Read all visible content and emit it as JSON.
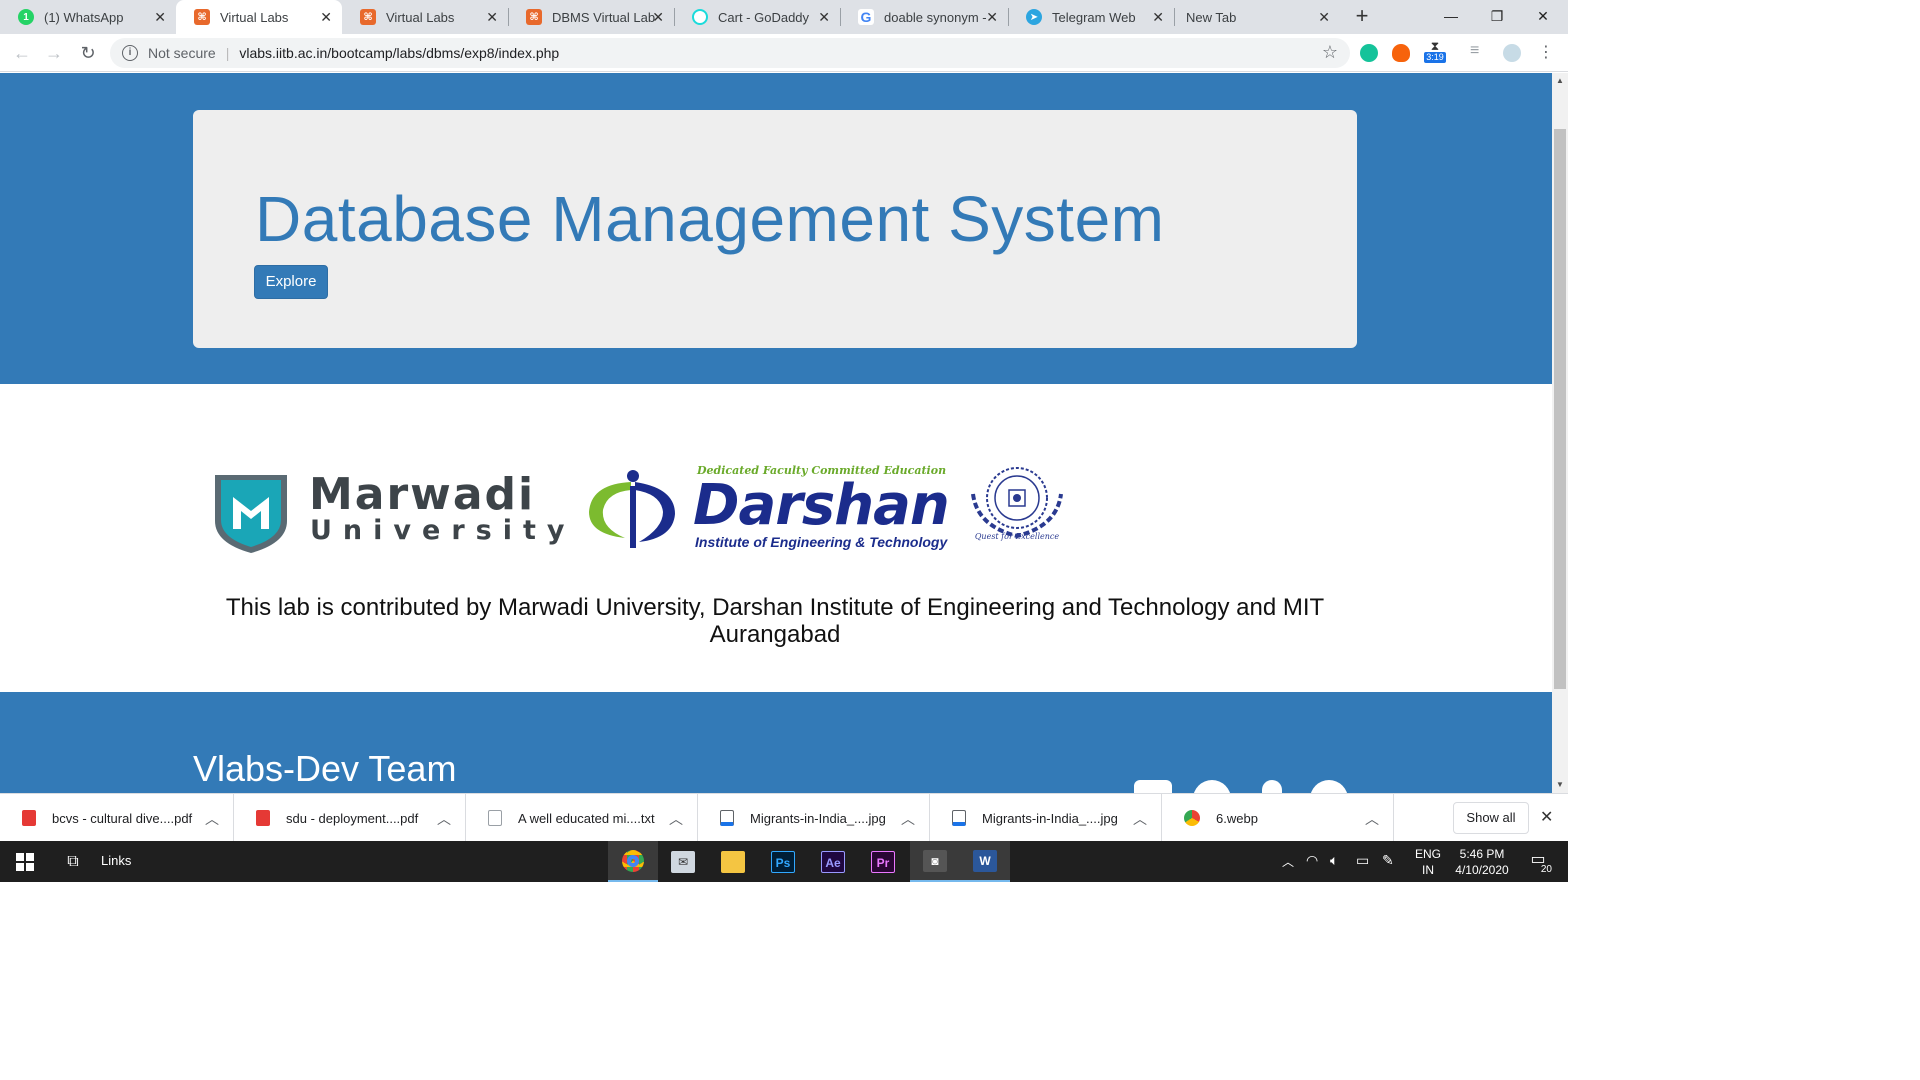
{
  "tabs": [
    {
      "title": "(1) WhatsApp",
      "icon": "whatsapp-icon",
      "color": "#25d366",
      "active": false
    },
    {
      "title": "Virtual Labs",
      "icon": "virtual-labs-icon",
      "color": "#e8692c",
      "active": true
    },
    {
      "title": "Virtual Labs",
      "icon": "virtual-labs-icon",
      "color": "#e8692c",
      "active": false
    },
    {
      "title": "DBMS Virtual Lab",
      "icon": "virtual-labs-icon",
      "color": "#e8692c",
      "active": false
    },
    {
      "title": "Cart - GoDaddy",
      "icon": "godaddy-icon",
      "color": "#1bdbdb",
      "active": false
    },
    {
      "title": "doable synonym -",
      "icon": "google-icon",
      "color": "#4285f4",
      "active": false
    },
    {
      "title": "Telegram Web",
      "icon": "telegram-icon",
      "color": "#2ca5e0",
      "active": false
    },
    {
      "title": "New Tab",
      "icon": "",
      "color": "",
      "active": false
    }
  ],
  "omnibox": {
    "security": "Not secure",
    "url": "vlabs.iitb.ac.in/bootcamp/labs/dbms/exp8/index.php"
  },
  "extensions": {
    "timer_badge": "3:19"
  },
  "page": {
    "title": "Database Management System",
    "explore_label": "Explore",
    "logos": {
      "marwadi_line1": "Marwadi",
      "marwadi_line2": "University",
      "darshan_tagline": "Dedicated Faculty Committed Education",
      "darshan_name": "Darshan",
      "darshan_sub": "Institute of Engineering & Technology",
      "mit_caption": "Quest for Excellence"
    },
    "contribution": "This lab is contributed by Marwadi University, Darshan Institute of Engineering and Technology and MIT Aurangabad",
    "footer_title": "Vlabs-Dev Team"
  },
  "downloads": [
    {
      "name": "bcvs - cultural dive....pdf",
      "type": "pdf"
    },
    {
      "name": "sdu - deployment....pdf",
      "type": "pdf"
    },
    {
      "name": "A well educated mi....txt",
      "type": "txt"
    },
    {
      "name": "Migrants-in-India_....jpg",
      "type": "jpg"
    },
    {
      "name": "Migrants-in-India_....jpg",
      "type": "jpg"
    },
    {
      "name": "6.webp",
      "type": "webp"
    }
  ],
  "shelf": {
    "show_all": "Show all"
  },
  "taskbar": {
    "links_label": "Links",
    "lang1": "ENG",
    "lang2": "IN",
    "time": "5:46 PM",
    "date": "4/10/2020",
    "notifications": "20"
  },
  "colors": {
    "brand": "#337ab7",
    "jumbotron": "#eeeeee"
  }
}
